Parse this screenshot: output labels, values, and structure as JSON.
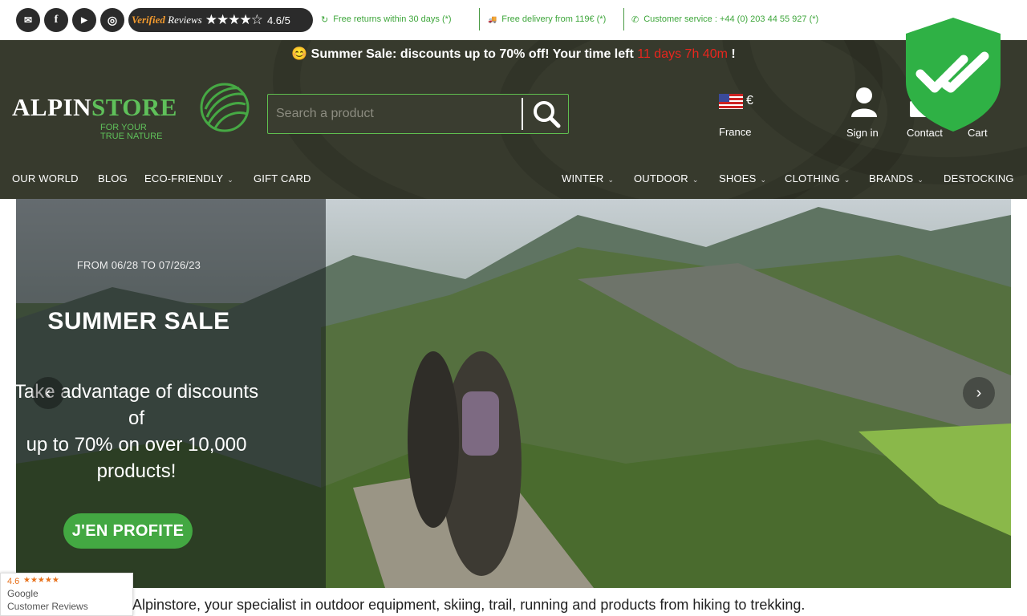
{
  "topbar": {
    "social": [
      {
        "icon": "email-icon",
        "glyph": "✉"
      },
      {
        "icon": "facebook-icon",
        "glyph": "f"
      },
      {
        "icon": "youtube-icon",
        "glyph": "▶"
      },
      {
        "icon": "instagram-icon",
        "glyph": "◎"
      }
    ],
    "reviews": {
      "brand_a": "Verified",
      "brand_b": "Reviews",
      "stars": "★★★★☆",
      "rating": "4.6/5"
    },
    "info": [
      {
        "icon": "return-icon",
        "glyph": "↻",
        "text": "Free returns within 30 days (*)"
      },
      {
        "icon": "truck-icon",
        "glyph": "🚚",
        "text": "Free delivery from 119€ (*)"
      },
      {
        "icon": "phone-icon",
        "glyph": "✆",
        "text": "Customer service : +44 (0) 203 44 55 927 (*)"
      }
    ]
  },
  "promo": {
    "emoji": "😊",
    "text": "Summer Sale: discounts up to 70% off! Your time left",
    "timer": "11 days 7h 40m",
    "end": "!"
  },
  "logo": {
    "alpin": "ALPIN",
    "store": "STORE",
    "tagline1": "FOR YOUR",
    "tagline2": "TRUE NATURE"
  },
  "search": {
    "placeholder": "Search a product"
  },
  "header": {
    "currency": "€",
    "country": "France",
    "sign_in": "Sign in",
    "contact": "Contact",
    "cart": "Cart"
  },
  "nav_left": [
    "OUR WORLD",
    "BLOG",
    "ECO-FRIENDLY",
    "GIFT CARD"
  ],
  "nav_right": [
    "WINTER",
    "OUTDOOR",
    "SHOES",
    "CLOTHING",
    "BRANDS",
    "DESTOCKING"
  ],
  "hero": {
    "dates": "FROM 06/28 TO 07/26/23",
    "title": "SUMMER SALE",
    "desc_line1": "Take advantage of discounts of",
    "desc_line2": "up to 70% on over 10,000",
    "desc_line3": "products!",
    "cta": "J'EN PROFITE"
  },
  "google": {
    "rating": "4.6",
    "stars": "★★★★★",
    "brand": "Google",
    "label": "Customer Reviews"
  },
  "intro": "Alpinstore, your specialist in outdoor equipment, skiing, trail, running and products from hiking to trekking.",
  "colors": {
    "header_bg": "#373a2d",
    "accent_green": "#43a842",
    "timer_red": "#e8261e"
  }
}
